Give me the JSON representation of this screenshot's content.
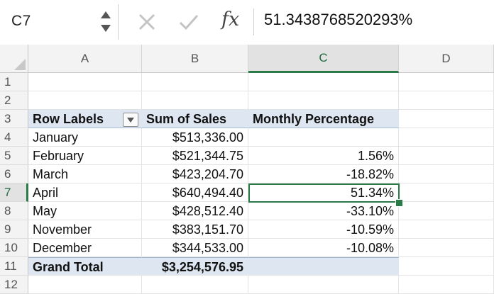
{
  "formula_bar": {
    "name_box": "C7",
    "fx_label": "fx",
    "content": "51.3438768520293%"
  },
  "colors": {
    "accent": "#2a7a47",
    "pivot_header_bg": "#dde6f1"
  },
  "columns": [
    "A",
    "B",
    "C",
    "D"
  ],
  "rows": [
    "1",
    "2",
    "3",
    "4",
    "5",
    "6",
    "7",
    "8",
    "9",
    "10",
    "11",
    "12"
  ],
  "pivot": {
    "headers": [
      "Row Labels",
      "Sum of Sales",
      "Monthly Percentage"
    ],
    "data": [
      {
        "label": "January",
        "sales": "$513,336.00",
        "pct": ""
      },
      {
        "label": "February",
        "sales": "$521,344.75",
        "pct": "1.56%"
      },
      {
        "label": "March",
        "sales": "$423,204.70",
        "pct": "-18.82%"
      },
      {
        "label": "April",
        "sales": "$640,494.40",
        "pct": "51.34%"
      },
      {
        "label": "May",
        "sales": "$428,512.40",
        "pct": "-33.10%"
      },
      {
        "label": "November",
        "sales": "$383,151.70",
        "pct": "-10.59%"
      },
      {
        "label": "December",
        "sales": "$344,533.00",
        "pct": "-10.08%"
      }
    ],
    "total": {
      "label": "Grand Total",
      "sales": "$3,254,576.95",
      "pct": ""
    }
  },
  "icons": {
    "filter": "dropdown-filter-icon",
    "cancel": "x-icon",
    "confirm": "check-icon"
  }
}
